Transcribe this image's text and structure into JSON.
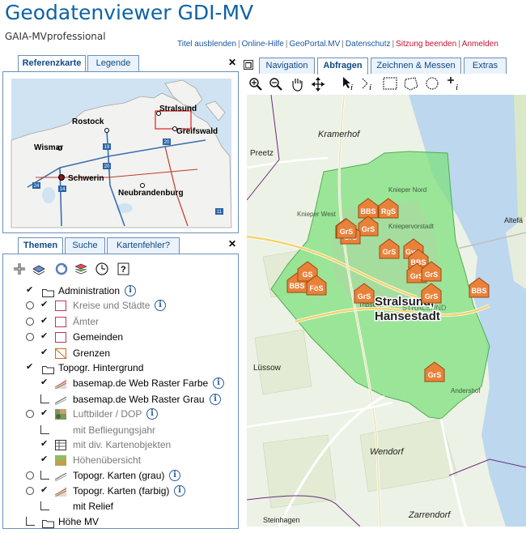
{
  "app": {
    "title": "Geodatenviewer GDI-MV",
    "subtitle": "GAIA-MVprofessional"
  },
  "top_links": {
    "titel": "Titel ausblenden",
    "hilfe": "Online-Hilfe",
    "geoportal": "GeoPortal.MV",
    "datenschutz": "Datenschutz",
    "beenden": "Sitzung beenden",
    "anmelden": "Anmelden",
    "separator": "|"
  },
  "left_tabs_top": {
    "referenzkarte": "Referenzkarte",
    "legende": "Legende"
  },
  "left_tabs_bottom": {
    "themen": "Themen",
    "suche": "Suche",
    "kartenfehler": "Kartenfehler?"
  },
  "map_tabs": {
    "navigation": "Navigation",
    "abfragen": "Abfragen",
    "zeichnen": "Zeichnen & Messen",
    "extras": "Extras"
  },
  "info_glyph": "i",
  "check_glyph": "✔",
  "layers": [
    {
      "label": "Administration",
      "type": "folder",
      "checked": true,
      "info": true,
      "grey": false
    },
    {
      "label": "Kreise und Städte",
      "type": "layer",
      "radio": true,
      "checked": true,
      "info": true,
      "grey": true,
      "swatch": "pink"
    },
    {
      "label": "Ämter",
      "type": "layer",
      "radio": true,
      "checked": true,
      "info": false,
      "grey": true,
      "swatch": "pink"
    },
    {
      "label": "Gemeinden",
      "type": "layer",
      "radio": true,
      "checked": true,
      "info": false,
      "grey": false,
      "swatch": "pink"
    },
    {
      "label": "Grenzen",
      "type": "layer",
      "radio": false,
      "checked": true,
      "info": false,
      "grey": false,
      "swatch": "border"
    },
    {
      "label": "Topogr. Hintergrund",
      "type": "folder",
      "checked": true,
      "info": false,
      "grey": false
    },
    {
      "label": "basemap.de Web Raster Farbe",
      "type": "layer",
      "radio": false,
      "checked": true,
      "info": true,
      "grey": false,
      "swatch": "raster-color"
    },
    {
      "label": "basemap.de Web Raster Grau",
      "type": "layer",
      "radio": false,
      "checked": false,
      "info": true,
      "grey": false,
      "swatch": "raster-grey"
    },
    {
      "label": "Luftbilder / DOP",
      "type": "layer",
      "radio": true,
      "checked": true,
      "info": true,
      "grey": true,
      "swatch": "photo"
    },
    {
      "label": "mit Befliegungsjahr",
      "type": "sub",
      "radio": false,
      "checked": false,
      "info": false,
      "grey": true,
      "swatch": "none"
    },
    {
      "label": "mit div. Kartenobjekten",
      "type": "sub",
      "radio": false,
      "checked": true,
      "info": false,
      "grey": true,
      "swatch": "grid"
    },
    {
      "label": "Höhenübersicht",
      "type": "sub",
      "radio": false,
      "checked": true,
      "info": false,
      "grey": true,
      "swatch": "terrain"
    },
    {
      "label": "Topogr. Karten (grau)",
      "type": "layer",
      "radio": true,
      "checked": false,
      "info": true,
      "grey": false,
      "swatch": "raster-grey"
    },
    {
      "label": "Topogr. Karten (farbig)",
      "type": "layer",
      "radio": true,
      "checked": true,
      "info": true,
      "grey": false,
      "swatch": "raster-color"
    },
    {
      "label": "mit Relief",
      "type": "sub",
      "radio": false,
      "checked": false,
      "info": false,
      "grey": false,
      "swatch": "none"
    },
    {
      "label": "Höhe MV",
      "type": "folder",
      "radio": false,
      "checked": false,
      "info": false,
      "grey": false
    }
  ],
  "overview_map": {
    "labels": {
      "stralsund": "Stralsund",
      "rostock": "Rostock",
      "greifswald": "Greifswald",
      "wismar": "Wismar",
      "schwerin": "Schwerin",
      "neubrandenburg": "Neubrandenburg"
    },
    "shields": [
      "19",
      "20",
      "20",
      "24",
      "14",
      "11"
    ]
  },
  "main_map": {
    "city_label_1": "Stralsund,",
    "city_label_2": "Hansestadt",
    "place_labels": {
      "kramerhof": "Kramerhof",
      "preetz": "Preetz",
      "luessow": "Lüssow",
      "wendorf": "Wendorf",
      "zarrendorf": "Zarrendorf",
      "steinhagen": "Steinhagen",
      "altefaehr": "Altefä",
      "knieper_nord": "Knieper Nord",
      "knieper_west": "Knieper West",
      "kniepervorstadt": "Kniepervorstadt",
      "triebseer": "Tribseer",
      "andershof": "Andershof",
      "stralsund_small": "STRALSUND"
    },
    "schools": [
      "BBS",
      "RgS",
      "GrS",
      "GrS",
      "GrS",
      "GrS",
      "Gym",
      "BBS",
      "GrS",
      "GrS",
      "BBS",
      "GS",
      "FöS",
      "GrS",
      "GrS",
      "GrS",
      "BBS",
      "GrS"
    ]
  },
  "colors": {
    "title": "#0e63a5",
    "highlight": "#7fe07f",
    "school": "#e8813a"
  }
}
